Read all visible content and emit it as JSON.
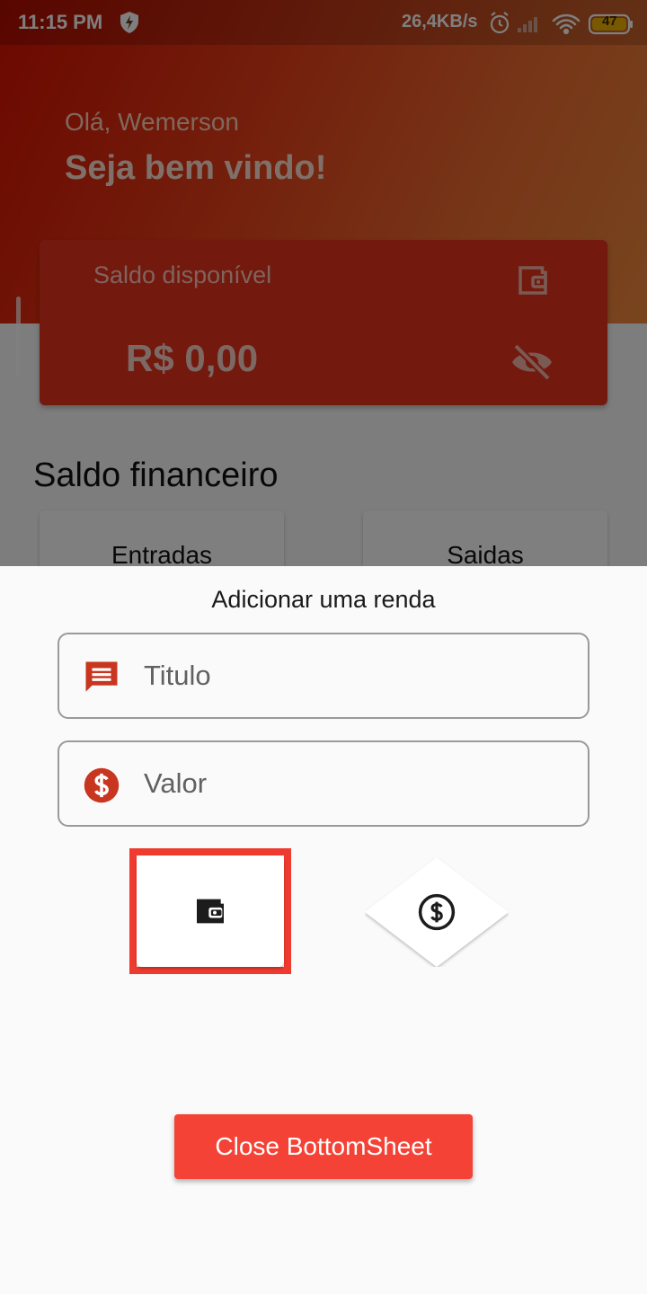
{
  "status_bar": {
    "time": "11:15 PM",
    "network_speed": "26,4KB/s",
    "battery": "47",
    "icons": [
      "shield-bolt-icon",
      "alarm-icon",
      "signal-icon",
      "wifi-icon",
      "battery-icon"
    ]
  },
  "header": {
    "greeting": "Olá, Wemerson",
    "welcome": "Seja bem vindo!"
  },
  "balance_card": {
    "label": "Saldo disponível",
    "value": "R$ 0,00",
    "icons": [
      "wallet-icon",
      "eye-off-icon"
    ]
  },
  "financial": {
    "title": "Saldo financeiro",
    "entries_label": "Entradas",
    "exits_label": "Saidas"
  },
  "bottom_sheet": {
    "title": "Adicionar uma renda",
    "title_field": {
      "placeholder": "Titulo",
      "value": "",
      "icon": "message-icon"
    },
    "value_field": {
      "placeholder": "Valor",
      "value": "",
      "icon": "dollar-circle-icon"
    },
    "type_options": [
      {
        "icon": "wallet-icon",
        "selected": true
      },
      {
        "icon": "dollar-circle-outline-icon",
        "selected": false
      }
    ],
    "close_label": "Close BottomSheet"
  },
  "colors": {
    "primary": "#f44336",
    "accent_icon": "#c8361f",
    "selection_border": "#ef3b2f"
  }
}
